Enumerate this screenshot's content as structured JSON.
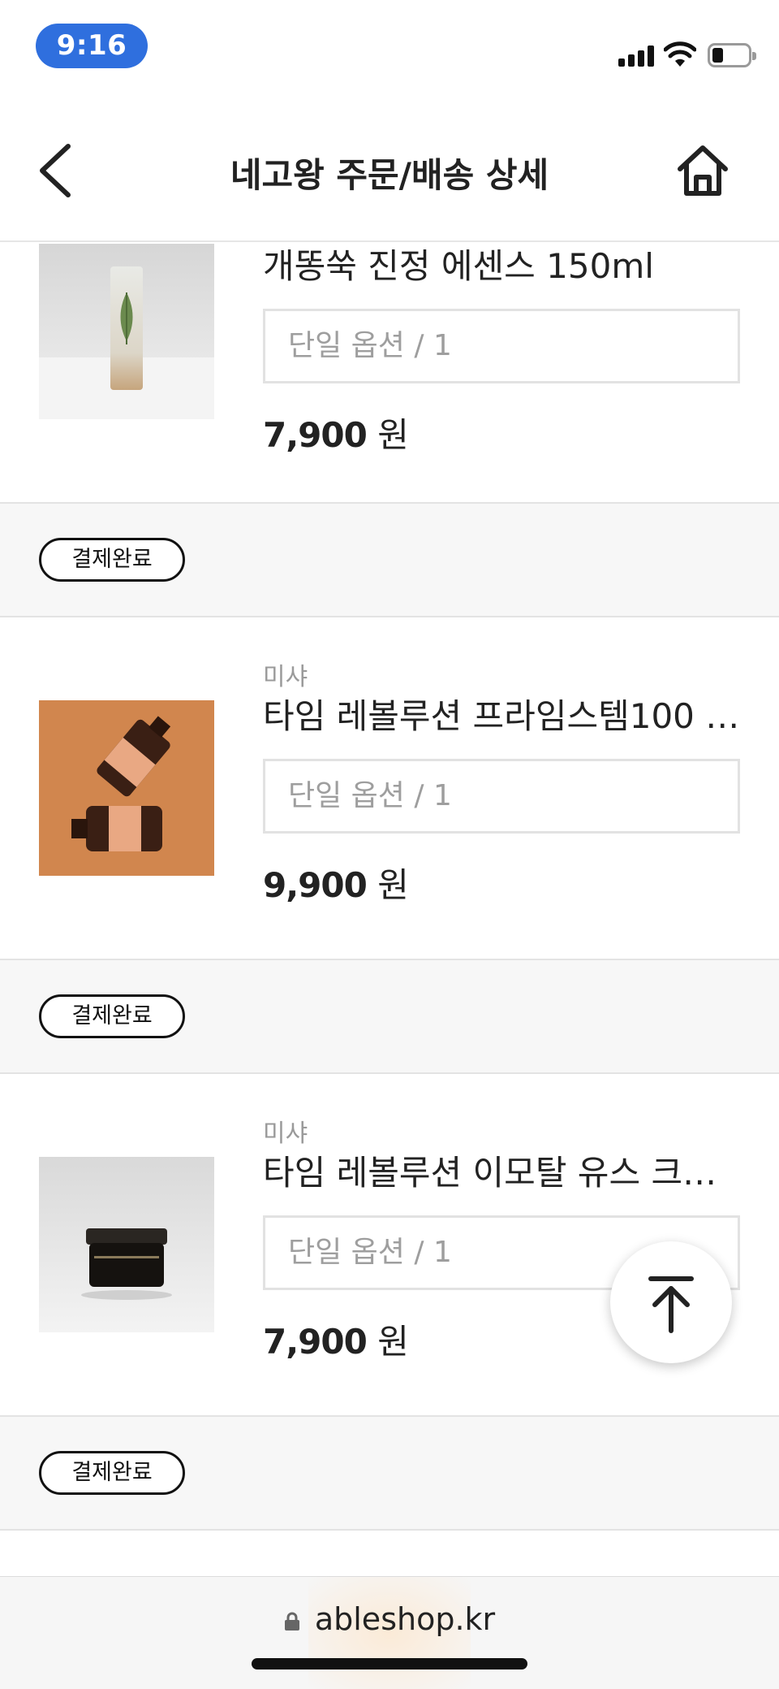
{
  "status_bar": {
    "time": "9:16"
  },
  "nav": {
    "title": "네고왕 주문/배송 상세"
  },
  "products": [
    {
      "brand": "",
      "name": "개똥쑥 진정 에센스 150ml",
      "option": "단일 옵션 / 1",
      "price": "7,900",
      "currency": "원",
      "status": "결제완료"
    },
    {
      "brand": "미샤",
      "name": "타임 레볼루션 프라임스템100 리...",
      "option": "단일 옵션 / 1",
      "price": "9,900",
      "currency": "원",
      "status": "결제완료"
    },
    {
      "brand": "미샤",
      "name": "타임 레볼루션 이모탈 유스 크림 ...",
      "option": "단일 옵션 / 1",
      "price": "7,900",
      "currency": "원",
      "status": "결제완료"
    }
  ],
  "browser": {
    "url": "ableshop.kr"
  },
  "icons": {
    "back": "chevron-left-icon",
    "home": "home-icon",
    "scroll_top": "arrow-up-to-top-icon",
    "lock": "lock-icon"
  }
}
